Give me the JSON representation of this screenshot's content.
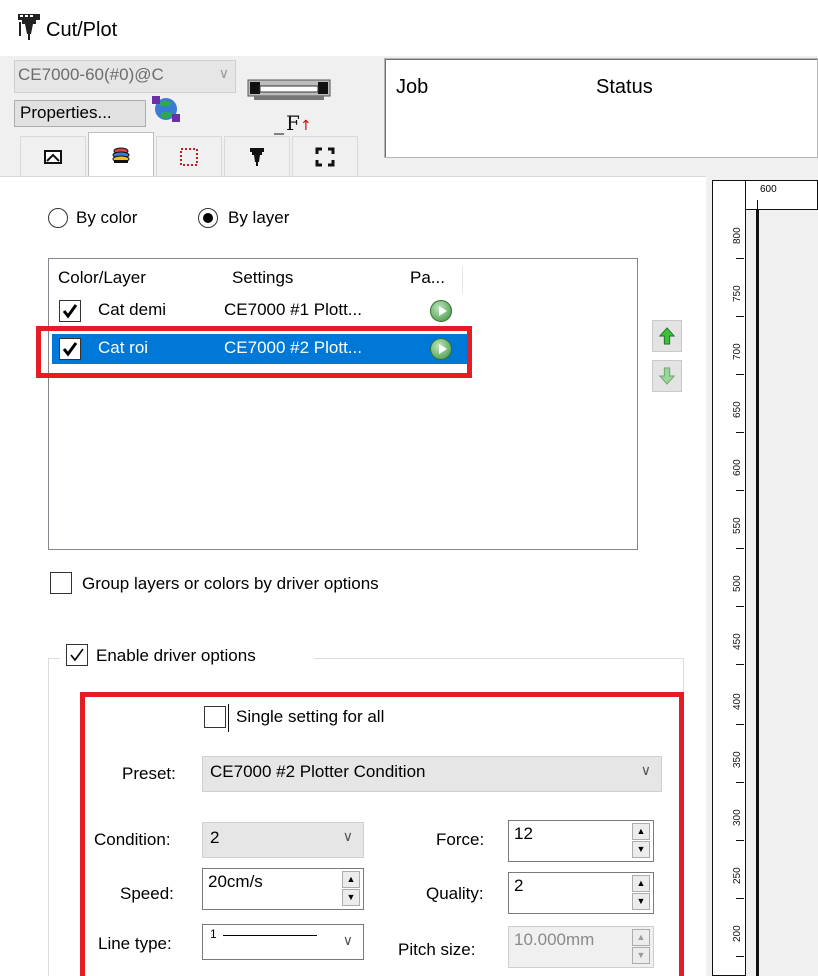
{
  "window": {
    "title": "Cut/Plot"
  },
  "top": {
    "printer_select": "CE7000-60(#0)@C",
    "properties_label": "Properties...",
    "job_header": "Job",
    "status_header": "Status"
  },
  "tabs": [
    {
      "icon": "page-setup-icon",
      "active": false
    },
    {
      "icon": "layer-pen-icon",
      "active": true
    },
    {
      "icon": "dotted-frame-icon",
      "active": false
    },
    {
      "icon": "plotter-icon",
      "active": false
    },
    {
      "icon": "crop-marks-icon",
      "active": false
    }
  ],
  "mode": {
    "by_color": "By color",
    "by_layer": "By layer",
    "selected": "By layer"
  },
  "layer_list": {
    "headers": {
      "color_layer": "Color/Layer",
      "settings": "Settings",
      "pass": "Pa..."
    },
    "rows": [
      {
        "name": "Cat demi",
        "settings": "CE7000 #1 Plott...",
        "checked": true,
        "selected": false
      },
      {
        "name": "Cat roi",
        "settings": "CE7000 #2 Plott...",
        "checked": true,
        "selected": true
      }
    ]
  },
  "options": {
    "group_layers": "Group layers or colors by driver options",
    "group_layers_checked": false,
    "enable_driver": "Enable driver options",
    "enable_driver_checked": true
  },
  "driver": {
    "single_setting": "Single setting for all",
    "single_setting_checked": false,
    "preset_label": "Preset:",
    "preset_value": "CE7000 #2 Plotter Condition",
    "condition_label": "Condition:",
    "condition_value": "2",
    "force_label": "Force:",
    "force_value": "12",
    "speed_label": "Speed:",
    "speed_value": "20cm/s",
    "quality_label": "Quality:",
    "quality_value": "2",
    "line_type_label": "Line type:",
    "line_type_value": "1",
    "pitch_label": "Pitch size:",
    "pitch_value": "10.000mm"
  },
  "ruler": {
    "top_label": "600",
    "side_labels": [
      "800",
      "750",
      "700",
      "650",
      "600",
      "550",
      "500",
      "450",
      "400",
      "350",
      "300",
      "250",
      "200"
    ]
  },
  "colors": {
    "highlight": "#e51c23",
    "selection": "#0078d7"
  }
}
